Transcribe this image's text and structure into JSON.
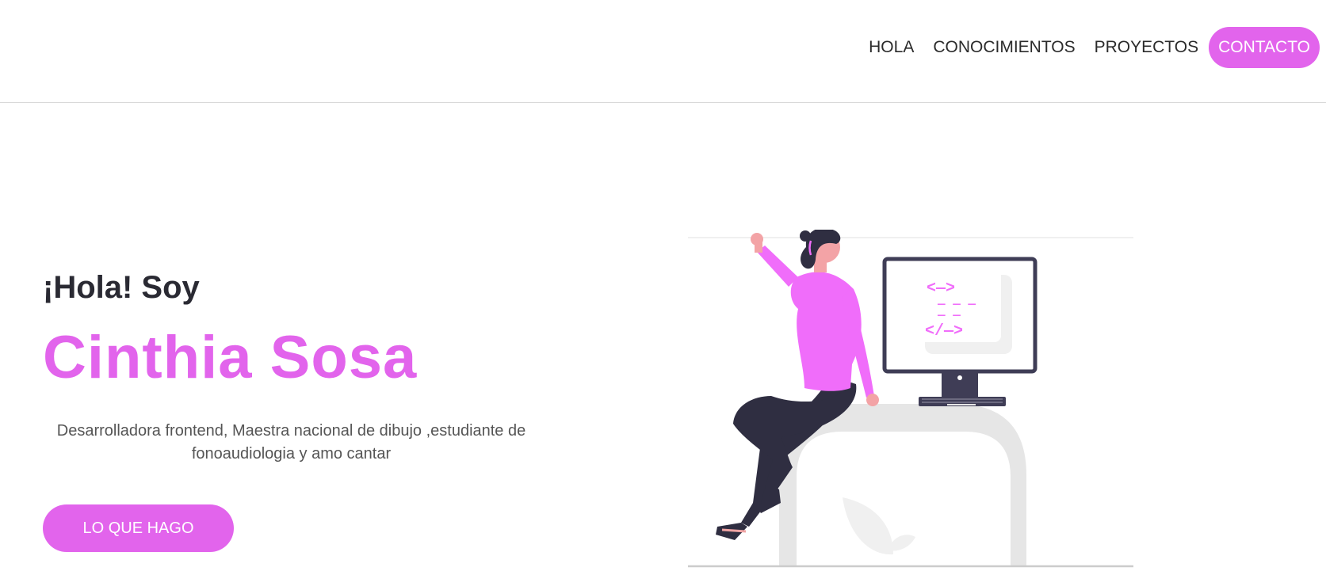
{
  "nav": {
    "links": [
      "HOLA",
      "CONOCIMIENTOS",
      "PROYECTOS"
    ],
    "contact": "CONTACTO"
  },
  "hero": {
    "greeting": "¡Hola! Soy",
    "name": "Cinthia Sosa",
    "description": "Desarrolladora frontend, Maestra nacional de dibujo ,estudiante de fonoaudiologia y amo cantar",
    "cta": "LO QUE HAGO",
    "illustration": {
      "code_lines": [
        "<—>",
        "— — —",
        "— —",
        "</—>"
      ]
    }
  },
  "colors": {
    "accent": "#e264ec",
    "text_dark": "#2a2a33",
    "text_muted": "#555555",
    "figure_top": "#f06dfa",
    "figure_pants": "#2f2e41"
  }
}
